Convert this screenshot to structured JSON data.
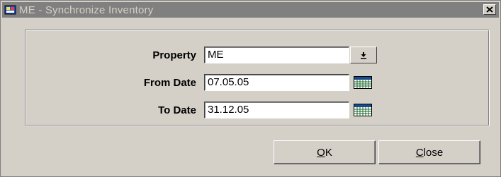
{
  "window": {
    "title": "ME - Synchronize Inventory",
    "icons": {
      "app": "app-icon",
      "close": "close-icon"
    }
  },
  "form": {
    "property": {
      "label": "Property",
      "value": "ME",
      "button_icon": "dropdown-arrow-icon"
    },
    "from_date": {
      "label": "From Date",
      "value": "07.05.05",
      "button_icon": "calendar-icon"
    },
    "to_date": {
      "label": "To Date",
      "value": "31.12.05",
      "button_icon": "calendar-icon"
    }
  },
  "buttons": {
    "ok": {
      "mnemonic": "O",
      "rest": "K"
    },
    "close": {
      "mnemonic": "C",
      "rest": "lose"
    }
  }
}
